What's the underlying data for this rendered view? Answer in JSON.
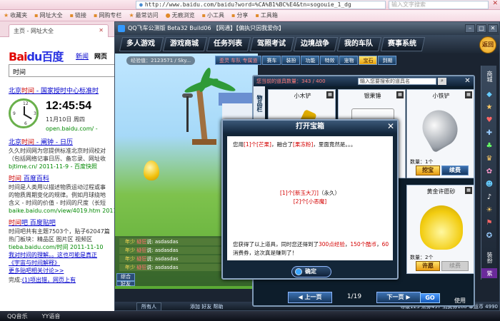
{
  "browser": {
    "url": "http://www.baidu.com/baidu?word=%CA%B1%BC%E4&tn=sogouie_1_dg",
    "search_placeholder": "输入文字搜索",
    "bookmarks": [
      "收藏夹",
      "网址大全",
      "链接",
      "网购专栏",
      "最常访问",
      "无痕浏览",
      "小工具",
      "分享",
      "工具箱"
    ],
    "tab_label": "主页 - 网址大全"
  },
  "baidu": {
    "logo_bai": "Bai",
    "logo_du": "du百度",
    "nav_news": "新闻",
    "nav_web": "网页",
    "query": "时间",
    "r1_title_pre": "北京",
    "r1_title_hl": "时间",
    "r1_title_post": " - 国家授时中心标准时",
    "clock_time": "12:45:54",
    "clock_date": "11月10日 周四",
    "clock_url": "open.baidu.com/ - ",
    "r2_title_pre": "北京",
    "r2_title_hl": "时间",
    "r2_title_post": " - 阐钟 - 日历",
    "r2_text1": "久久时间网为您提供标准北京时间校对",
    "r2_text2": "（包括网络记事日历、备忘录、网址收",
    "r2_url": "bjtime.cn/ 2011-11-9 - 百度快照",
    "r3_title_hl": "时间",
    "r3_title_post": " 百度百科",
    "r3_text1": "时间是人类用以描述物质运动过程或事",
    "r3_text2": "的物质周期变化的规律。例如月球绕地",
    "r3_text3": "含义 - 时间的价值 - 时间的尺度（长短",
    "r3_url": "baike.baidu.com/view/4019.htm 2011-11",
    "r4_title_hl": "时间",
    "r4_title_post": "吧 百度贴吧",
    "r4_text1": "时间吧共有主题7503个，贴子62047篇",
    "r4_text2": "热门板块：精品区 图片区 视频区",
    "r4_url": "tieba.baidu.com/时间 2011-11-10",
    "r4_text3": "我对时间的理解。。这也可能是真正",
    "r4_text4": "《宇宙与时间解释》",
    "r4_more": "更多贴吧相关讨论>>",
    "r5_text": "完成:",
    "r5_link": "(1)项出错，网页上有"
  },
  "game": {
    "window_title": "QQ飞车公测版 Beta32 Build06 【网通】【偏执只因我爱你】",
    "menu": [
      "多人游戏",
      "游戏商城",
      "任务列表",
      "驾照考试",
      "边境战争",
      "我的车队",
      "赛事系统"
    ],
    "back": "返回",
    "exp_info": "经验值：2123571 / Sky...",
    "subtabs": [
      "赛车",
      "装扮",
      "功能",
      "特效",
      "宠物",
      "宝石",
      "到期"
    ],
    "subtab_extra": "歪灵 车队 专属道",
    "items_head": "您当前的道具数量：343 / 400",
    "items_search": "输入您要搜索的道具名",
    "items_vtab": "物品栏",
    "cards": [
      {
        "name": "小木铲",
        "count": "",
        "btn1": "",
        "btn2": ""
      },
      {
        "name": "银果锤",
        "count": "",
        "btn1": "",
        "btn2": ""
      },
      {
        "name": "小铁铲",
        "count": "数量：1个",
        "btn1": "挖宝",
        "btn2": "续费"
      },
      {
        "name": "黄金许愿砂",
        "count": "数量：2个",
        "btn1": "许愿",
        "btn2": "续费"
      }
    ],
    "chat": [
      {
        "tag": "年少",
        "user": "疑狂",
        "text": "说: asdasdas"
      },
      {
        "tag": "年少",
        "user": "疑狂",
        "text": "说: asdasdas"
      },
      {
        "tag": "年少",
        "user": "疑狂",
        "text": "说: asdasdas"
      },
      {
        "tag": "年少",
        "user": "疑狂",
        "text": "说: asdasdas"
      }
    ],
    "chat_tabs": [
      "综合",
      "好友"
    ],
    "chat_all": "所有人",
    "menu_round": "菜单",
    "pager_prev": "上一页",
    "pager_num": "1/19",
    "pager_next": "下一页",
    "go": "GO",
    "use_label": "使用",
    "right_tabs": [
      "商城",
      "装扮",
      "紫"
    ],
    "bottom_left": "添加 好友 帮助",
    "bottom_right": "等级123  点券497  消费券180  幸运币 4990",
    "ok": "确定",
    "dialog_title": "打开宝箱",
    "dlg_pre": "您用",
    "dlg_item1": "[1]个[芒果]",
    "dlg_mid": "，融合了",
    "dlg_item2": "[果冻粉]",
    "dlg_post": "，里面竟然是。。。",
    "dlg_get1": "[1]个[新玉大刀]",
    "dlg_get1_note": "（永久）",
    "dlg_get2": "[2]个[小恶魔]",
    "dlg_bottom1": "您获得了以上道具，同时您还得到了",
    "dlg_exp": "300点经验",
    "dlg_sep": "，",
    "dlg_coin": "150个酷币",
    "dlg_sep2": "，",
    "dlg_voucher": "60",
    "dlg_bottom2": "消费券，这次真是赚到了！"
  },
  "taskbar": {
    "items": [
      "QQ音乐",
      "YY语音"
    ]
  }
}
